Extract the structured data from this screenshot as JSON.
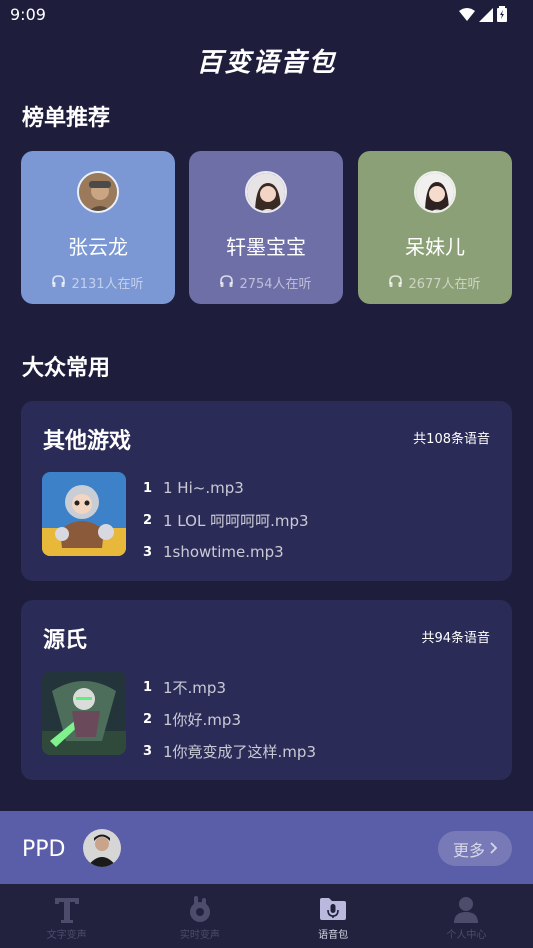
{
  "status_bar": {
    "time": "9:09"
  },
  "app": {
    "title": "百变语音包"
  },
  "ranking": {
    "title": "榜单推荐",
    "cards": [
      {
        "name": "张云龙",
        "listeners": "2131人在听",
        "color": "#7b98d4"
      },
      {
        "name": "轩墨宝宝",
        "listeners": "2754人在听",
        "color": "#6f6fa8"
      },
      {
        "name": "呆妹儿",
        "listeners": "2677人在听",
        "color": "#8ca078"
      }
    ]
  },
  "common": {
    "title": "大众常用",
    "categories": [
      {
        "title": "其他游戏",
        "count": "共108条语音",
        "tracks": [
          {
            "num": "1",
            "name": "1 Hi~.mp3"
          },
          {
            "num": "2",
            "name": "1 LOL 呵呵呵呵.mp3"
          },
          {
            "num": "3",
            "name": "1showtime.mp3"
          }
        ]
      },
      {
        "title": "源氏",
        "count": "共94条语音",
        "tracks": [
          {
            "num": "1",
            "name": "1不.mp3"
          },
          {
            "num": "2",
            "name": "1你好.mp3"
          },
          {
            "num": "3",
            "name": "1你竟变成了这样.mp3"
          }
        ]
      }
    ]
  },
  "banner": {
    "label": "PPD",
    "more": "更多"
  },
  "nav": {
    "items": [
      {
        "label": "文字变声",
        "icon": "text-icon"
      },
      {
        "label": "实时变声",
        "icon": "realtime-voice-icon"
      },
      {
        "label": "语音包",
        "icon": "voice-pack-icon"
      },
      {
        "label": "个人中心",
        "icon": "profile-icon"
      }
    ],
    "active_index": 2
  },
  "colors": {
    "background": "#1e1e3c",
    "card": "#2b2b57",
    "banner": "#5a5da8"
  }
}
